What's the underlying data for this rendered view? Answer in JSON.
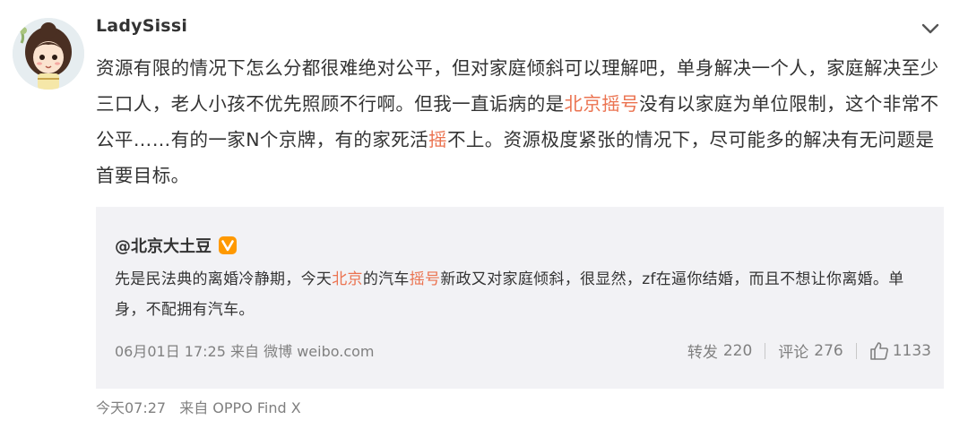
{
  "post": {
    "username": "LadySissi",
    "text_segments": [
      {
        "text": "资源有限的情况下怎么分都很难绝对公平，但对家庭倾斜可以理解吧，单身解决一个人，家庭解决至少三口人，老人小孩不优先照顾不行啊。但我一直诟病的是",
        "highlight": false
      },
      {
        "text": "北京摇号",
        "highlight": true
      },
      {
        "text": "没有以家庭为单位限制，这个非常不公平……有的一家N个京牌，有的家死活",
        "highlight": false
      },
      {
        "text": "摇",
        "highlight": true
      },
      {
        "text": "不上。资源极度紧张的情况下，尽可能多的解决有无问题是首要目标。",
        "highlight": false
      }
    ],
    "time": "今天07:27",
    "source": "来自 OPPO Find X"
  },
  "repost": {
    "author": "@北京大土豆",
    "text_segments": [
      {
        "text": "先是民法典的离婚冷静期，今天",
        "highlight": false
      },
      {
        "text": "北京",
        "highlight": true
      },
      {
        "text": "的汽车",
        "highlight": false
      },
      {
        "text": "摇号",
        "highlight": true
      },
      {
        "text": "新政又对家庭倾斜，很显然，zf在逼你结婚，而且不想让你离婚。单身，不配拥有汽车。",
        "highlight": false
      }
    ],
    "time": "06月01日 17:25",
    "source": "来自 微博 weibo.com",
    "repost_label": "转发",
    "repost_count": "220",
    "comment_label": "评论",
    "comment_count": "276",
    "like_count": "1133"
  },
  "colors": {
    "highlight": "#eb7350",
    "verified_badge": "#ff9900",
    "repost_bg": "#f2f2f5",
    "meta_text": "#808080"
  },
  "icons": [
    "chevron-down-icon",
    "verified-badge-icon",
    "thumbs-up-icon"
  ]
}
